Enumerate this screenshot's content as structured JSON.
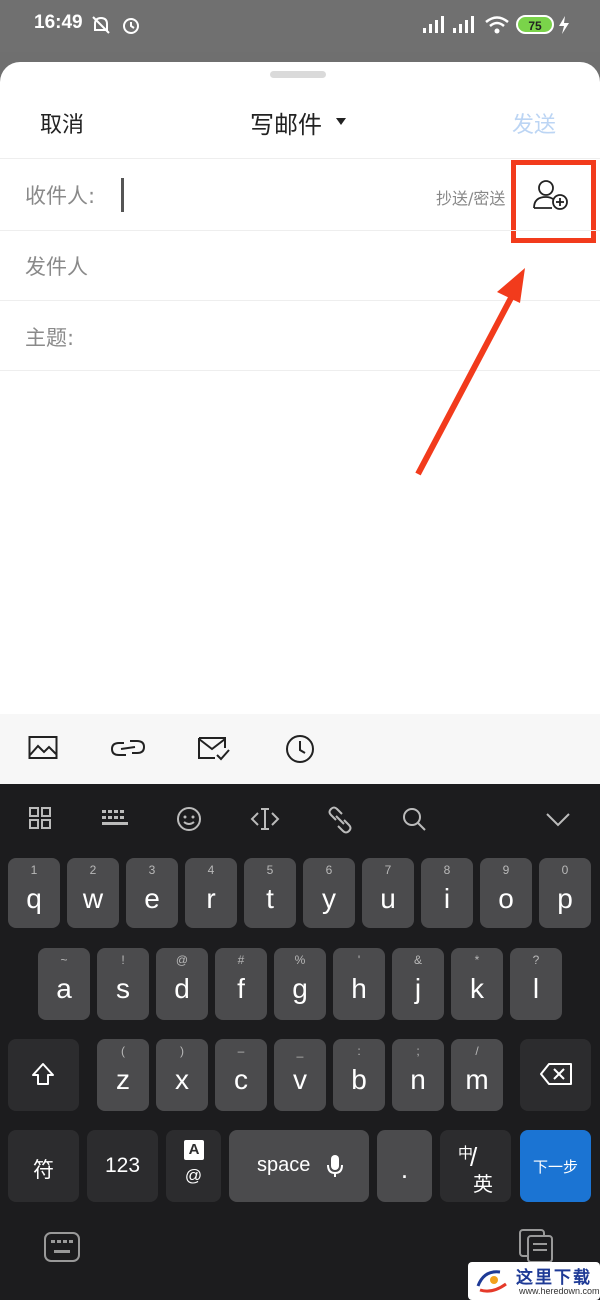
{
  "status_bar": {
    "time": "16:49",
    "battery": "75"
  },
  "header": {
    "cancel_label": "取消",
    "title": "写邮件",
    "send_label": "发送"
  },
  "fields": {
    "to_label": "收件人:",
    "cc_bcc_label": "抄送/密送",
    "from_label": "发件人",
    "subject_label": "主题:"
  },
  "attachments": [
    "image-icon",
    "link-icon",
    "mail-check-icon",
    "clock-icon"
  ],
  "keyboard": {
    "row1": [
      {
        "hint": "1",
        "key": "q"
      },
      {
        "hint": "2",
        "key": "w"
      },
      {
        "hint": "3",
        "key": "e"
      },
      {
        "hint": "4",
        "key": "r"
      },
      {
        "hint": "5",
        "key": "t"
      },
      {
        "hint": "6",
        "key": "y"
      },
      {
        "hint": "7",
        "key": "u"
      },
      {
        "hint": "8",
        "key": "i"
      },
      {
        "hint": "9",
        "key": "o"
      },
      {
        "hint": "0",
        "key": "p"
      }
    ],
    "row2": [
      {
        "hint": "~",
        "key": "a"
      },
      {
        "hint": "!",
        "key": "s"
      },
      {
        "hint": "@",
        "key": "d"
      },
      {
        "hint": "#",
        "key": "f"
      },
      {
        "hint": "%",
        "key": "g"
      },
      {
        "hint": "'",
        "key": "h"
      },
      {
        "hint": "&",
        "key": "j"
      },
      {
        "hint": "*",
        "key": "k"
      },
      {
        "hint": "?",
        "key": "l"
      }
    ],
    "row3": [
      {
        "hint": "(",
        "key": "z"
      },
      {
        "hint": ")",
        "key": "x"
      },
      {
        "hint": "–",
        "key": "c"
      },
      {
        "hint": "_",
        "key": "v"
      },
      {
        "hint": ":",
        "key": "b"
      },
      {
        "hint": ";",
        "key": "n"
      },
      {
        "hint": "/",
        "key": "m"
      }
    ],
    "symbol_label": "符",
    "numbers_label": "123",
    "alpha_top": "A",
    "alpha_bottom": "@",
    "space_label": "space",
    "period_label": ".",
    "lang_top": "中",
    "lang_bottom": "英",
    "next_label": "下一步"
  },
  "watermark": {
    "text": "这里下载",
    "url": "www.heredown.com"
  },
  "colors": {
    "highlight": "#f23b1c",
    "send_disabled": "#bcd5f4",
    "next_key": "#1b74d3"
  }
}
